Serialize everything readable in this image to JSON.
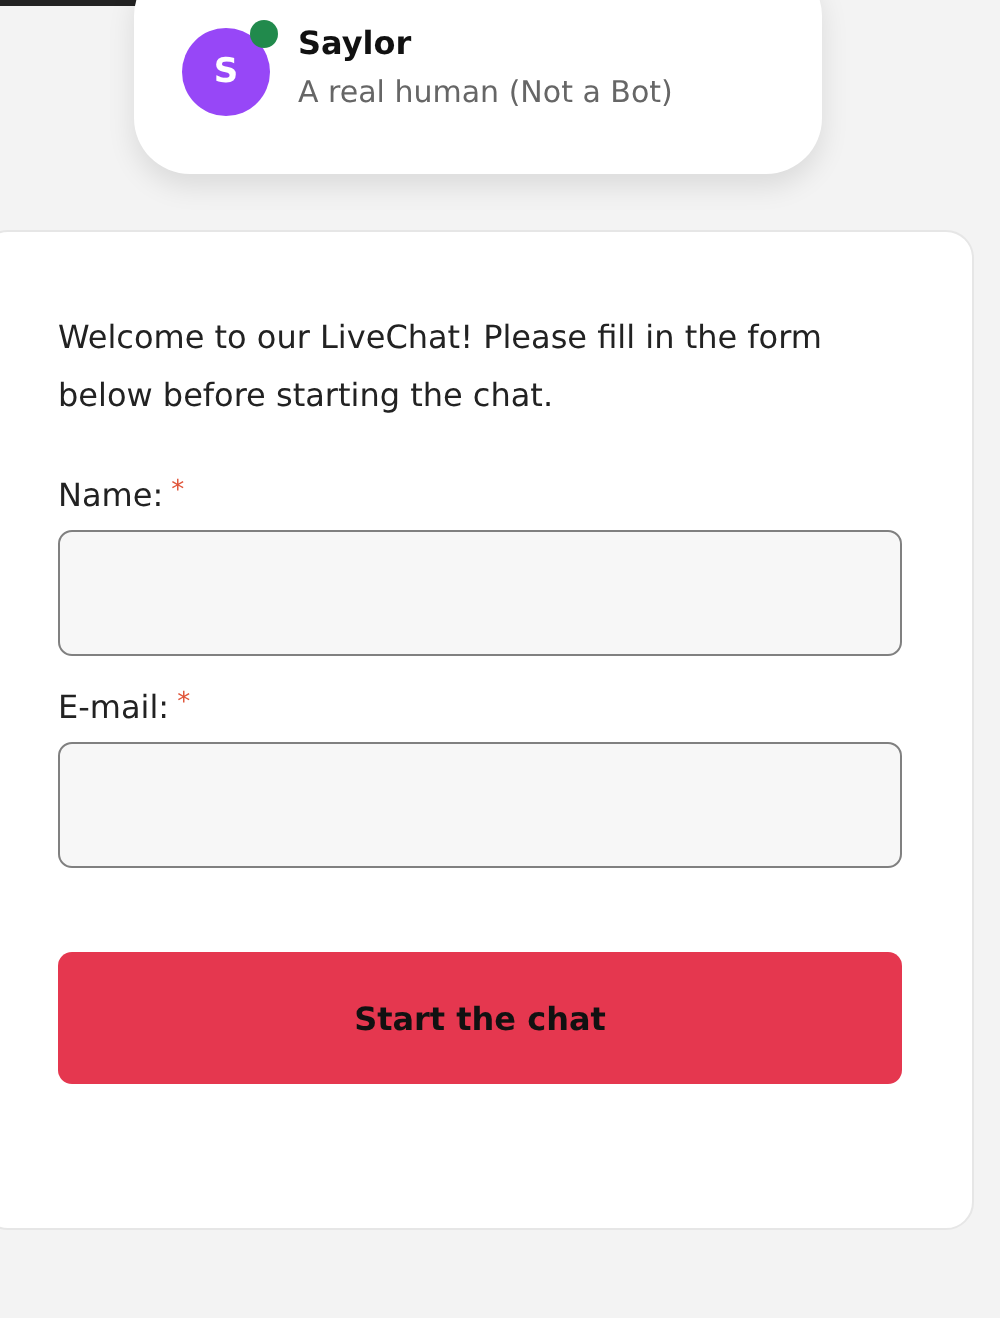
{
  "agent": {
    "initial": "S",
    "name": "Saylor",
    "subtitle": "A real human (Not a Bot)",
    "online": true
  },
  "intro": "Welcome to our LiveChat! Please fill in the form below before starting the chat.",
  "fields": [
    {
      "label": "Name:",
      "required_mark": "*"
    },
    {
      "label": "E-mail:",
      "required_mark": "*"
    }
  ],
  "submit": "Start the chat"
}
